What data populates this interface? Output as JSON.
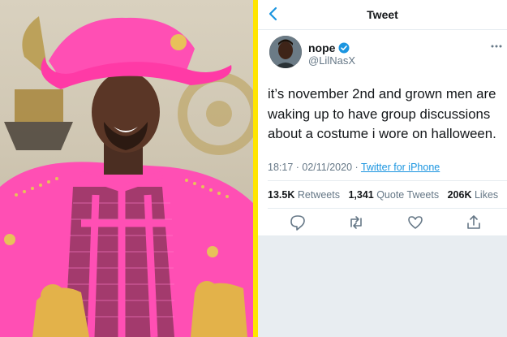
{
  "header": {
    "title": "Tweet"
  },
  "author": {
    "display_name": "nope",
    "handle": "@LilNasX",
    "verified": true
  },
  "tweet": {
    "text": "it’s november 2nd and grown men are waking up to have group discussions about a costume i wore on halloween.",
    "time": "18:17",
    "date": "02/11/2020",
    "source": "Twitter for iPhone"
  },
  "stats": {
    "retweets_count": "13.5K",
    "retweets_label": "Retweets",
    "quote_count": "1,341",
    "quote_label": "Quote Tweets",
    "likes_count": "206K",
    "likes_label": "Likes"
  },
  "colors": {
    "accent": "#1b95e0",
    "divider": "#ffe500",
    "outfit": "#ff4fb4"
  }
}
